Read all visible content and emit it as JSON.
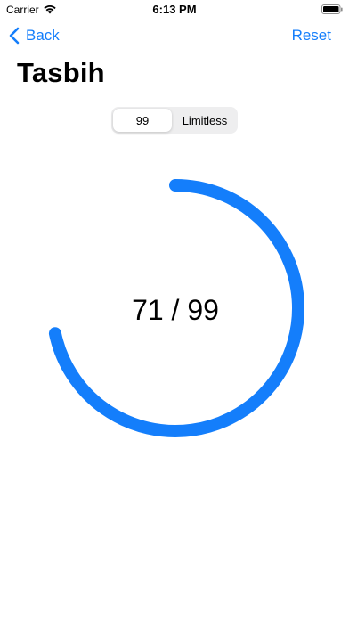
{
  "status_bar": {
    "carrier": "Carrier",
    "time": "6:13 PM",
    "icons": [
      "wifi-icon",
      "battery-icon"
    ]
  },
  "nav": {
    "back_label": "Back",
    "reset_label": "Reset",
    "back_icon": "chevron-left-icon"
  },
  "title": "Tasbih",
  "mode_selector": {
    "options": [
      "99",
      "Limitless"
    ],
    "selected": "99"
  },
  "counter": {
    "count": 71,
    "target": 99,
    "label": "71 / 99"
  },
  "colors": {
    "accent": "#147efb",
    "segment_background": "#eeeeef",
    "text": "#000000",
    "background": "#ffffff"
  }
}
